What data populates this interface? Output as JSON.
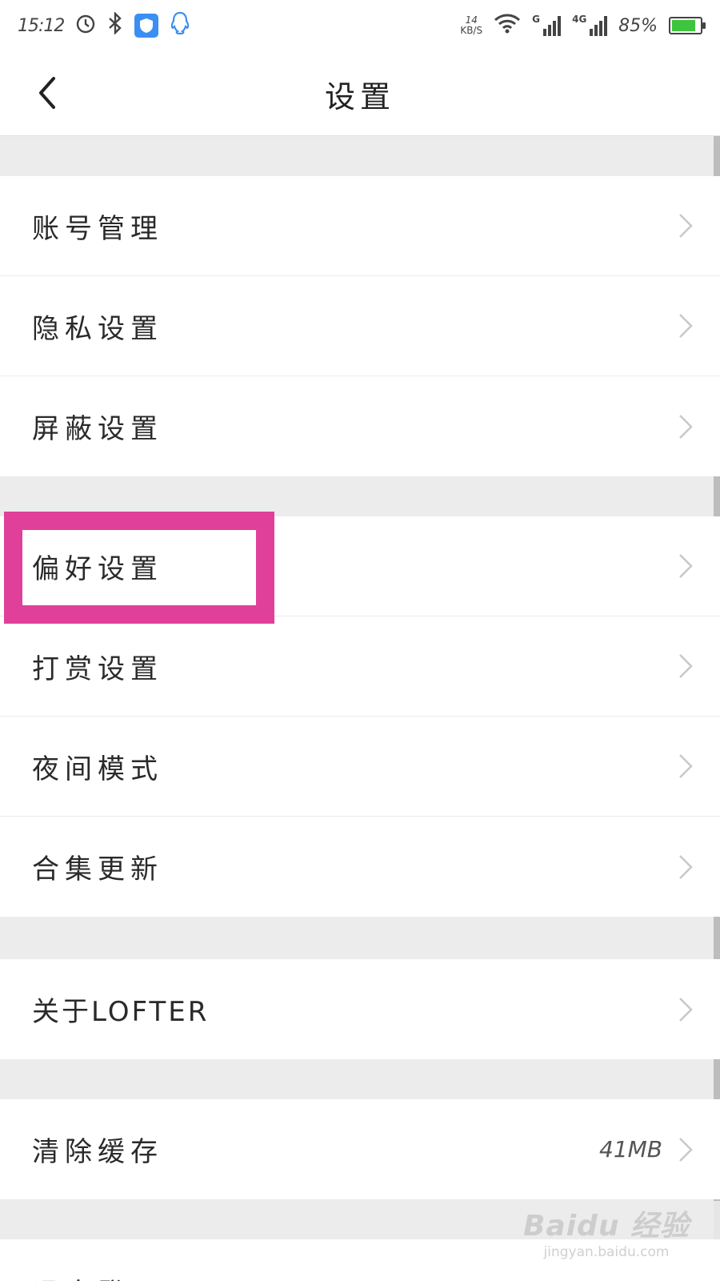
{
  "status_bar": {
    "time": "15:12",
    "net_speed_value": "14",
    "net_speed_unit": "KB/S",
    "signal1_tag": "G",
    "signal2_tag": "4G",
    "battery_text": "85%",
    "battery_level": 0.85,
    "battery_color": "#3ec43e",
    "shield_color": "#3b8ff3",
    "qq_color": "#3b8ff3"
  },
  "header": {
    "back_icon": "chevron-left-icon",
    "title": "设置"
  },
  "settings": {
    "group1": [
      {
        "label": "账号管理"
      },
      {
        "label": "隐私设置"
      },
      {
        "label": "屏蔽设置"
      }
    ],
    "group2": [
      {
        "label": "偏好设置"
      },
      {
        "label": "打赏设置"
      },
      {
        "label": "夜间模式"
      },
      {
        "label": "合集更新"
      }
    ],
    "group3": [
      {
        "label": "关于LOFTER"
      }
    ],
    "group4": [
      {
        "label": "清除缓存",
        "value": "41MB"
      }
    ],
    "group5": [
      {
        "label": "退出登录"
      }
    ]
  },
  "highlight_color": "#e0409a",
  "watermark": {
    "main": "Baidu 经验",
    "url": "jingyan.baidu.com"
  }
}
